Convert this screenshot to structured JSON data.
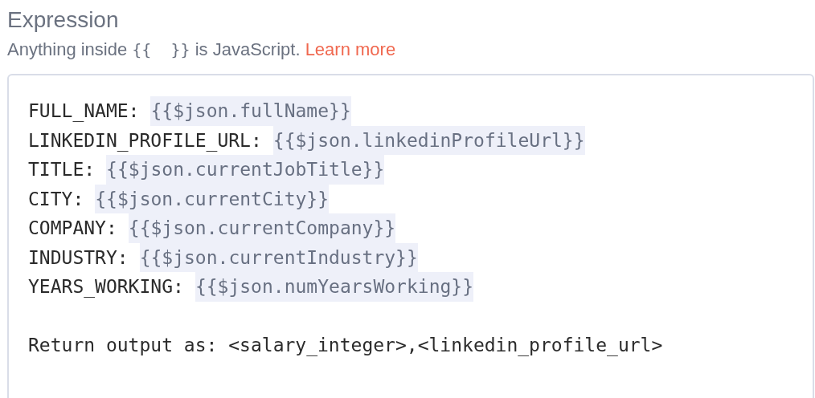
{
  "title": "Expression",
  "description": {
    "before": "Anything inside ",
    "code": "{{  }}",
    "after": " is JavaScript. ",
    "link": "Learn more"
  },
  "editor": {
    "lines": [
      {
        "label": "FULL_NAME:",
        "expression": "{{$json.fullName}}"
      },
      {
        "label": "LINKEDIN_PROFILE_URL:",
        "expression": "{{$json.linkedinProfileUrl}}"
      },
      {
        "label": "TITLE:",
        "expression": "{{$json.currentJobTitle}}"
      },
      {
        "label": "CITY:",
        "expression": "{{$json.currentCity}}"
      },
      {
        "label": "COMPANY:",
        "expression": "{{$json.currentCompany}}"
      },
      {
        "label": "INDUSTRY:",
        "expression": "{{$json.currentIndustry}}"
      },
      {
        "label": "YEARS_WORKING:",
        "expression": "{{$json.numYearsWorking}}"
      }
    ],
    "note": "Return output as: <salary_integer>,<linkedin_profile_url>"
  }
}
